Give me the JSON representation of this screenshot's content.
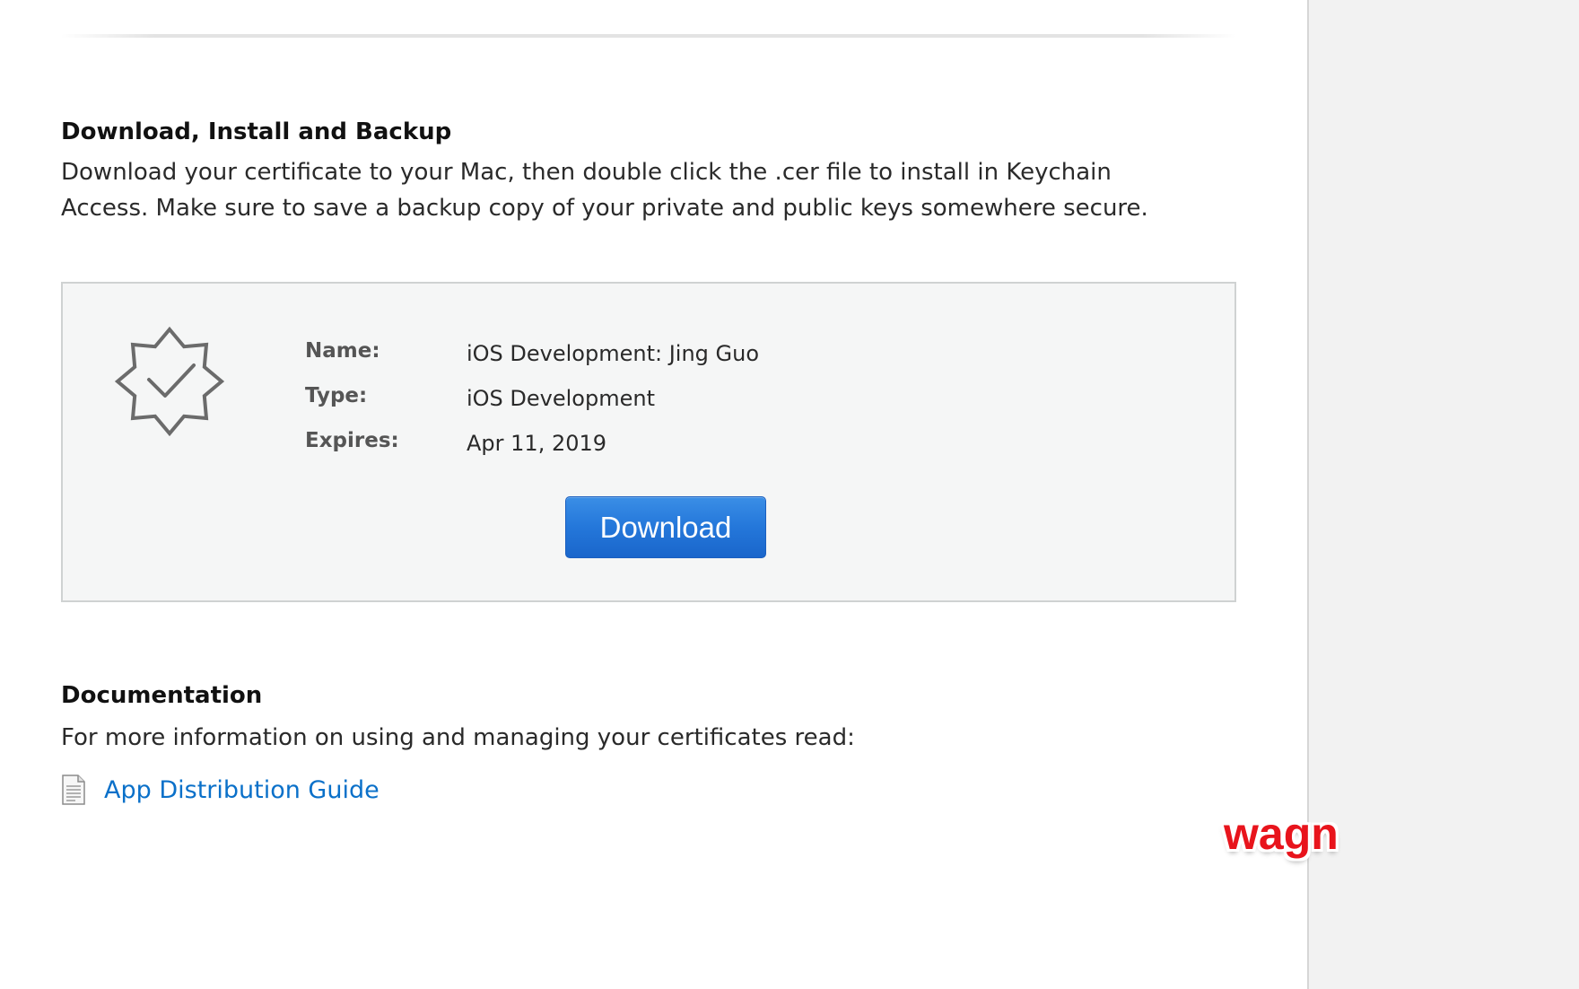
{
  "download_section": {
    "heading": "Download, Install and Backup",
    "body_line_1": "Download your certificate to your Mac, then double click the .cer file to install in Keychain",
    "body_line_2": "Access. Make sure to save a backup copy of your private and public keys somewhere secure."
  },
  "certificate": {
    "icon": "certificate-badge-icon",
    "rows": [
      {
        "label": "Name:",
        "value": "iOS Development: Jing Guo"
      },
      {
        "label": "Type:",
        "value": "iOS Development"
      },
      {
        "label": "Expires:",
        "value": "Apr 11, 2019"
      }
    ],
    "download_label": "Download",
    "accent_color": "#2477da"
  },
  "documentation": {
    "heading": "Documentation",
    "body": "For more information on using and managing your certificates read:",
    "link_label": "App Distribution Guide",
    "link_icon": "document-icon",
    "link_color": "#0a70c9"
  },
  "watermark": {
    "text": "wagn",
    "color": "#e8141c"
  }
}
